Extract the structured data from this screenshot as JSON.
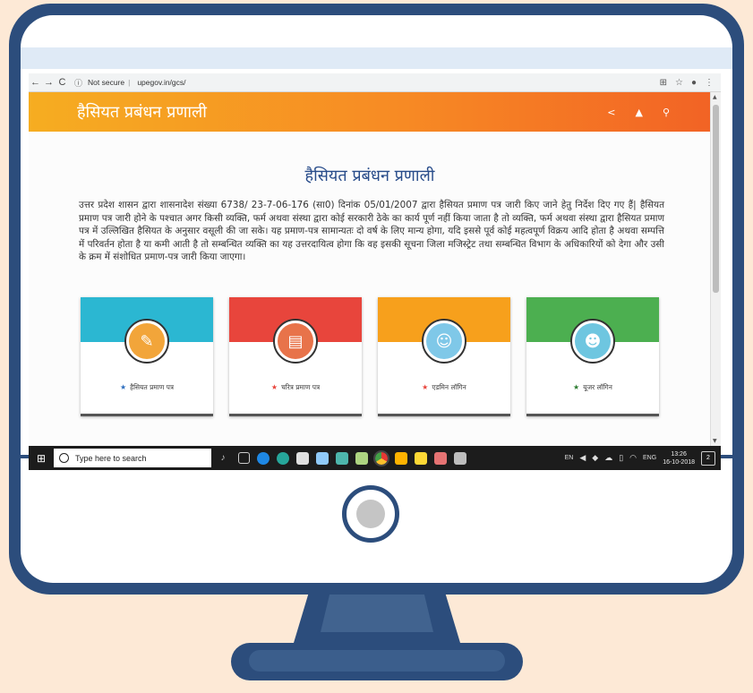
{
  "browser": {
    "back_glyph": "←",
    "forward_glyph": "→",
    "reload_glyph": "C",
    "security_label": "Not secure",
    "url": "upegov.in/gcs/"
  },
  "header": {
    "app_title": "हैसियत प्रबंधन प्रणाली"
  },
  "main": {
    "heading": "हैसियत प्रबंधन प्रणाली",
    "intro": "उत्तर प्रदेश शासन द्वारा शासनादेश संख्या 6738/ 23-7-06-176 (सा0) दिनांक 05/01/2007 द्वारा हैसियत प्रमाण पत्र जारी किए जाने हेतु निर्देश दिए गए हैं| हैसियत प्रमाण पत्र जारी होने के पश्चात अगर किसी व्यक्ति, फर्म अथवा संस्था द्वारा कोई सरकारी ठेके का कार्य पूर्ण नहीं किया जाता है तो व्यक्ति, फर्म अथवा संस्था द्वारा हैसियत प्रमाण पत्र में उल्लिखित हैसियत के अनुसार वसूली की जा सके। यह प्रमाण-पत्र सामान्यतः दो वर्ष के लिए मान्य होगा, यदि इससे पूर्व कोई महत्वपूर्ण विक्रय आदि होता है अथवा सम्पत्ति में परिवर्तन होता है या कमी आती है तो सम्बन्धित व्यक्ति का यह उत्तरदायित्व होगा कि वह इसकी सूचना जिला मजिस्ट्रेट तथा सम्बन्धित विभाग के अधिकारियों को देगा और उसी के क्रम में संशोधित प्रमाण-पत्र जारी किया जाएगा।",
    "cards": [
      {
        "label": "हैसियत प्रमाण पत्र",
        "color": "#2bb7d2",
        "icon": "document-icon",
        "star_color": "#2f6fbf"
      },
      {
        "label": "चरित्र प्रमाण पत्र",
        "color": "#e8453c",
        "icon": "certificate-icon",
        "star_color": "#e8453c"
      },
      {
        "label": "एडमिन लॉगिन",
        "color": "#f7a01c",
        "icon": "admin-icon",
        "star_color": "#e8453c"
      },
      {
        "label": "यूजर लॉगिन",
        "color": "#4caf50",
        "icon": "users-icon",
        "star_color": "#2e7d32"
      }
    ]
  },
  "taskbar": {
    "search_placeholder": "Type here to search",
    "lang_short": "EN",
    "lang": "ENG",
    "time": "13:26",
    "date": "16-10-2018",
    "notification_count": "2"
  }
}
